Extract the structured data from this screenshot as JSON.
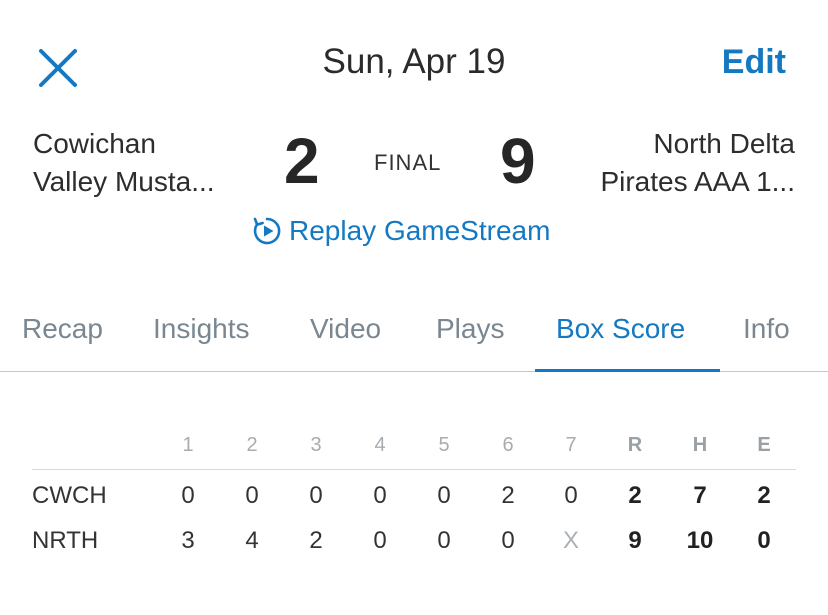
{
  "header": {
    "date": "Sun, Apr 19",
    "edit_label": "Edit",
    "close_icon": "close-icon"
  },
  "game": {
    "home_team_line1": "Cowichan",
    "home_team_line2": "Valley Musta...",
    "away_team_line1": "North Delta",
    "away_team_line2": "Pirates AAA 1...",
    "home_score": "2",
    "away_score": "9",
    "status": "FINAL",
    "replay_label": "Replay GameStream",
    "replay_icon": "replay-play-icon"
  },
  "tabs": [
    {
      "label": "Recap",
      "active": false
    },
    {
      "label": "Insights",
      "active": false
    },
    {
      "label": "Video",
      "active": false
    },
    {
      "label": "Plays",
      "active": false
    },
    {
      "label": "Box Score",
      "active": true
    },
    {
      "label": "Info",
      "active": false
    }
  ],
  "box_score": {
    "columns": [
      "1",
      "2",
      "3",
      "4",
      "5",
      "6",
      "7",
      "R",
      "H",
      "E"
    ],
    "rows": [
      {
        "team": "CWCH",
        "innings": [
          "0",
          "0",
          "0",
          "0",
          "0",
          "2",
          "0"
        ],
        "totals": [
          "2",
          "7",
          "2"
        ]
      },
      {
        "team": "NRTH",
        "innings": [
          "3",
          "4",
          "2",
          "0",
          "0",
          "0",
          "X"
        ],
        "totals": [
          "9",
          "10",
          "0"
        ]
      }
    ]
  },
  "colors": {
    "accent": "#1479c2",
    "tab_inactive": "#7a8791",
    "header_gray": "#a7acb0"
  }
}
